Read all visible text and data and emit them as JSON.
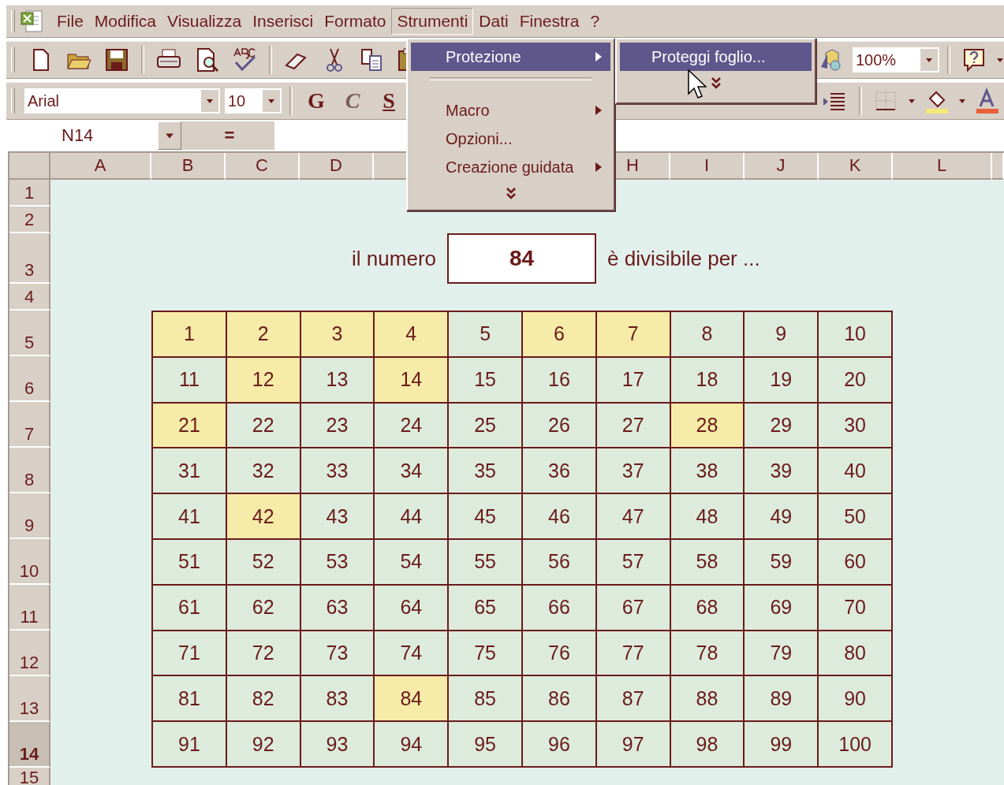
{
  "menu_bar": {
    "items": [
      {
        "label": "File",
        "selected": false
      },
      {
        "label": "Modifica",
        "selected": false
      },
      {
        "label": "Visualizza",
        "selected": false
      },
      {
        "label": "Inserisci",
        "selected": false
      },
      {
        "label": "Formato",
        "selected": false
      },
      {
        "label": "Strumenti",
        "selected": true
      },
      {
        "label": "Dati",
        "selected": false
      },
      {
        "label": "Finestra",
        "selected": false
      },
      {
        "label": "?",
        "selected": false
      }
    ]
  },
  "toolbar_standard": {
    "zoom": "100%"
  },
  "toolbar_format": {
    "font": "Arial",
    "size": "10",
    "style_buttons": [
      "G",
      "C",
      "S"
    ]
  },
  "formula_bar": {
    "name_box": "N14",
    "equals": "="
  },
  "sheet": {
    "columns_left": [
      {
        "label": "A"
      },
      {
        "label": "B"
      },
      {
        "label": "C"
      },
      {
        "label": "D"
      }
    ],
    "columns_right": [
      {
        "label": "H"
      },
      {
        "label": "I"
      },
      {
        "label": "J"
      },
      {
        "label": "K"
      },
      {
        "label": "L"
      }
    ],
    "rows": [
      {
        "label": "1",
        "selected": false
      },
      {
        "label": "2",
        "selected": false
      },
      {
        "label": "3",
        "selected": false
      },
      {
        "label": "4",
        "selected": false
      },
      {
        "label": "5",
        "selected": false
      },
      {
        "label": "6",
        "selected": false
      },
      {
        "label": "7",
        "selected": false
      },
      {
        "label": "8",
        "selected": false
      },
      {
        "label": "9",
        "selected": false
      },
      {
        "label": "10",
        "selected": false
      },
      {
        "label": "11",
        "selected": false
      },
      {
        "label": "12",
        "selected": false
      },
      {
        "label": "13",
        "selected": false
      },
      {
        "label": "14",
        "selected": true
      },
      {
        "label": "15",
        "selected": false
      }
    ]
  },
  "prompt": {
    "before": "il numero",
    "number": "84",
    "after": "è divisibile per ..."
  },
  "number_grid": [
    {
      "value": "1",
      "highlighted": true
    },
    {
      "value": "2",
      "highlighted": true
    },
    {
      "value": "3",
      "highlighted": true
    },
    {
      "value": "4",
      "highlighted": true
    },
    {
      "value": "5",
      "highlighted": false
    },
    {
      "value": "6",
      "highlighted": true
    },
    {
      "value": "7",
      "highlighted": true
    },
    {
      "value": "8",
      "highlighted": false
    },
    {
      "value": "9",
      "highlighted": false
    },
    {
      "value": "10",
      "highlighted": false
    },
    {
      "value": "11",
      "highlighted": false
    },
    {
      "value": "12",
      "highlighted": true
    },
    {
      "value": "13",
      "highlighted": false
    },
    {
      "value": "14",
      "highlighted": true
    },
    {
      "value": "15",
      "highlighted": false
    },
    {
      "value": "16",
      "highlighted": false
    },
    {
      "value": "17",
      "highlighted": false
    },
    {
      "value": "18",
      "highlighted": false
    },
    {
      "value": "19",
      "highlighted": false
    },
    {
      "value": "20",
      "highlighted": false
    },
    {
      "value": "21",
      "highlighted": true
    },
    {
      "value": "22",
      "highlighted": false
    },
    {
      "value": "23",
      "highlighted": false
    },
    {
      "value": "24",
      "highlighted": false
    },
    {
      "value": "25",
      "highlighted": false
    },
    {
      "value": "26",
      "highlighted": false
    },
    {
      "value": "27",
      "highlighted": false
    },
    {
      "value": "28",
      "highlighted": true
    },
    {
      "value": "29",
      "highlighted": false
    },
    {
      "value": "30",
      "highlighted": false
    },
    {
      "value": "31",
      "highlighted": false
    },
    {
      "value": "32",
      "highlighted": false
    },
    {
      "value": "33",
      "highlighted": false
    },
    {
      "value": "34",
      "highlighted": false
    },
    {
      "value": "35",
      "highlighted": false
    },
    {
      "value": "36",
      "highlighted": false
    },
    {
      "value": "37",
      "highlighted": false
    },
    {
      "value": "38",
      "highlighted": false
    },
    {
      "value": "39",
      "highlighted": false
    },
    {
      "value": "40",
      "highlighted": false
    },
    {
      "value": "41",
      "highlighted": false
    },
    {
      "value": "42",
      "highlighted": true
    },
    {
      "value": "43",
      "highlighted": false
    },
    {
      "value": "44",
      "highlighted": false
    },
    {
      "value": "45",
      "highlighted": false
    },
    {
      "value": "46",
      "highlighted": false
    },
    {
      "value": "47",
      "highlighted": false
    },
    {
      "value": "48",
      "highlighted": false
    },
    {
      "value": "49",
      "highlighted": false
    },
    {
      "value": "50",
      "highlighted": false
    },
    {
      "value": "51",
      "highlighted": false
    },
    {
      "value": "52",
      "highlighted": false
    },
    {
      "value": "53",
      "highlighted": false
    },
    {
      "value": "54",
      "highlighted": false
    },
    {
      "value": "55",
      "highlighted": false
    },
    {
      "value": "56",
      "highlighted": false
    },
    {
      "value": "57",
      "highlighted": false
    },
    {
      "value": "58",
      "highlighted": false
    },
    {
      "value": "59",
      "highlighted": false
    },
    {
      "value": "60",
      "highlighted": false
    },
    {
      "value": "61",
      "highlighted": false
    },
    {
      "value": "62",
      "highlighted": false
    },
    {
      "value": "63",
      "highlighted": false
    },
    {
      "value": "64",
      "highlighted": false
    },
    {
      "value": "65",
      "highlighted": false
    },
    {
      "value": "66",
      "highlighted": false
    },
    {
      "value": "67",
      "highlighted": false
    },
    {
      "value": "68",
      "highlighted": false
    },
    {
      "value": "69",
      "highlighted": false
    },
    {
      "value": "70",
      "highlighted": false
    },
    {
      "value": "71",
      "highlighted": false
    },
    {
      "value": "72",
      "highlighted": false
    },
    {
      "value": "73",
      "highlighted": false
    },
    {
      "value": "74",
      "highlighted": false
    },
    {
      "value": "75",
      "highlighted": false
    },
    {
      "value": "76",
      "highlighted": false
    },
    {
      "value": "77",
      "highlighted": false
    },
    {
      "value": "78",
      "highlighted": false
    },
    {
      "value": "79",
      "highlighted": false
    },
    {
      "value": "80",
      "highlighted": false
    },
    {
      "value": "81",
      "highlighted": false
    },
    {
      "value": "82",
      "highlighted": false
    },
    {
      "value": "83",
      "highlighted": false
    },
    {
      "value": "84",
      "highlighted": true
    },
    {
      "value": "85",
      "highlighted": false
    },
    {
      "value": "86",
      "highlighted": false
    },
    {
      "value": "87",
      "highlighted": false
    },
    {
      "value": "88",
      "highlighted": false
    },
    {
      "value": "89",
      "highlighted": false
    },
    {
      "value": "90",
      "highlighted": false
    },
    {
      "value": "91",
      "highlighted": false
    },
    {
      "value": "92",
      "highlighted": false
    },
    {
      "value": "93",
      "highlighted": false
    },
    {
      "value": "94",
      "highlighted": false
    },
    {
      "value": "95",
      "highlighted": false
    },
    {
      "value": "96",
      "highlighted": false
    },
    {
      "value": "97",
      "highlighted": false
    },
    {
      "value": "98",
      "highlighted": false
    },
    {
      "value": "99",
      "highlighted": false
    },
    {
      "value": "100",
      "highlighted": false
    }
  ],
  "menu": {
    "items": [
      {
        "kind": "item",
        "label": "Protezione",
        "submenu": true,
        "selected": true
      },
      {
        "kind": "separator"
      },
      {
        "kind": "item",
        "label": "Macro",
        "submenu": true,
        "selected": false
      },
      {
        "kind": "item",
        "label": "Opzioni...",
        "submenu": false,
        "selected": false
      },
      {
        "kind": "item",
        "label": "Creazione guidata",
        "submenu": true,
        "selected": false
      },
      {
        "kind": "more"
      }
    ]
  },
  "submenu": {
    "items": [
      {
        "kind": "item",
        "label": "Proteggi foglio...",
        "submenu": false,
        "selected": true
      },
      {
        "kind": "more"
      }
    ]
  }
}
